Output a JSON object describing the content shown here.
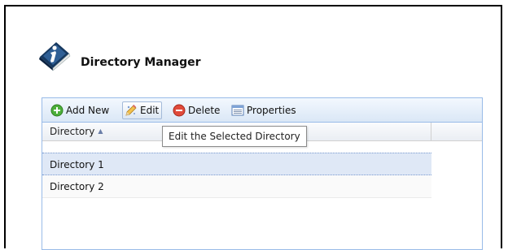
{
  "app": {
    "title": "Directory Manager",
    "icon": "info-book-icon"
  },
  "toolbar": {
    "buttons": [
      {
        "label": "Add New",
        "icon": "add-circle-icon"
      },
      {
        "label": "Edit",
        "icon": "pencil-icon"
      },
      {
        "label": "Delete",
        "icon": "delete-circle-icon"
      },
      {
        "label": "Properties",
        "icon": "properties-icon"
      }
    ]
  },
  "grid": {
    "column_header": "Directory",
    "sort_indicator": "▲",
    "rows": [
      {
        "name": "Directory 1",
        "selected": true
      },
      {
        "name": "Directory 2",
        "selected": false
      }
    ]
  },
  "tooltip": {
    "text": "Edit the Selected Directory"
  },
  "colors": {
    "toolbar_border": "#99bbe8",
    "selected_row": "#dfe8f6",
    "add_icon": "#4caf3a",
    "delete_icon": "#e04a3a"
  }
}
